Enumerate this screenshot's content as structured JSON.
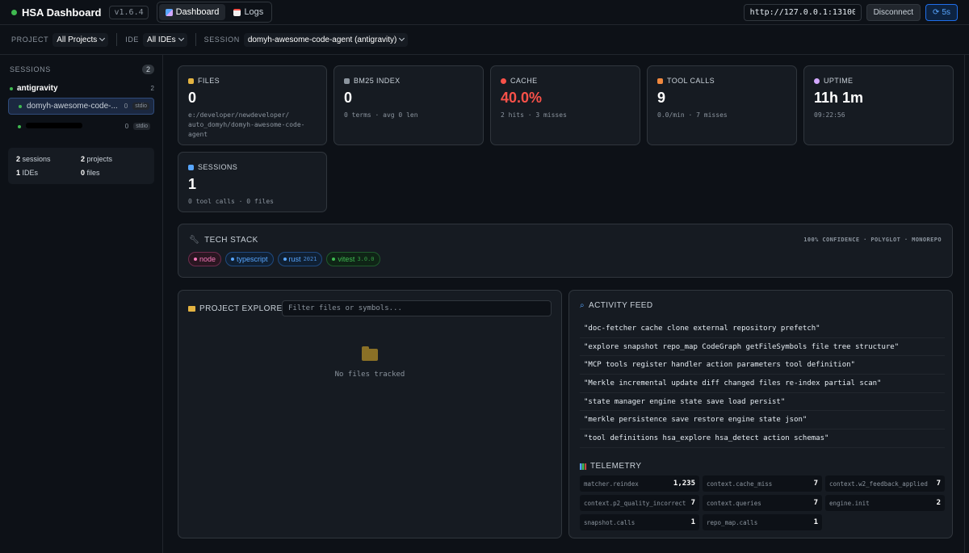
{
  "header": {
    "brand": "HSA Dashboard",
    "version": "v1.6.4",
    "tabs": [
      {
        "label": "Dashboard",
        "icon": "dashboard-icon",
        "active": true
      },
      {
        "label": "Logs",
        "icon": "logs-icon",
        "active": false
      }
    ],
    "server_url": "http://127.0.0.1:13100",
    "disconnect_label": "Disconnect",
    "refresh_label": "5s",
    "accent": "#58a6ff",
    "status_color": "#3fb950"
  },
  "filters": {
    "project_label": "PROJECT",
    "project_value": "All Projects",
    "ide_label": "IDE",
    "ide_value": "All IDEs",
    "session_label": "SESSION",
    "session_value": "domyh-awesome-code-agent (antigravity)"
  },
  "sidebar": {
    "title": "SESSIONS",
    "count": "2",
    "group": {
      "name": "antigravity",
      "count": "2"
    },
    "sessions": [
      {
        "name": "domyh-awesome-code-...",
        "calls": "0",
        "transport": "stdio"
      },
      {
        "name": "",
        "calls": "0",
        "transport": "stdio"
      }
    ],
    "stats": [
      {
        "num": "2",
        "label": "sessions"
      },
      {
        "num": "2",
        "label": "projects"
      },
      {
        "num": "1",
        "label": "IDEs"
      },
      {
        "num": "0",
        "label": "files"
      }
    ]
  },
  "metrics": [
    {
      "label": "FILES",
      "value": "0",
      "sub": "e:/developer/newdeveloper/\nauto_domyh/domyh-awesome-code-\nagent",
      "icon_color": "#e3b341"
    },
    {
      "label": "BM25 INDEX",
      "value": "0",
      "sub": "0 terms · avg 0 len",
      "icon_color": "#8b949e"
    },
    {
      "label": "CACHE",
      "value": "40.0%",
      "sub": "2 hits · 3 misses",
      "icon_color": "#f85149"
    },
    {
      "label": "TOOL CALLS",
      "value": "9",
      "sub": "0.0/min · 7 misses",
      "icon_color": "#f0883e"
    },
    {
      "label": "UPTIME",
      "value": "11h 1m",
      "sub": "09:22:56",
      "icon_color": "#d2a8ff"
    },
    {
      "label": "SESSIONS",
      "value": "1",
      "sub": "0 tool calls · 0 files",
      "icon_color": "#58a6ff"
    }
  ],
  "tech_stack": {
    "title": "TECH STACK",
    "meta": "100% CONFIDENCE · POLYGLOT · MONOREPO",
    "chips": [
      {
        "name": "node",
        "version": "",
        "color": "#f778ba"
      },
      {
        "name": "typescript",
        "version": "",
        "color": "#58a6ff"
      },
      {
        "name": "rust",
        "version": "2021",
        "color": "#58a6ff"
      },
      {
        "name": "vitest",
        "version": "3.0.0",
        "color": "#3fb950"
      }
    ]
  },
  "explorer": {
    "title": "PROJECT EXPLORER",
    "filter_placeholder": "Filter files or symbols...",
    "empty_text": "No files tracked"
  },
  "activity": {
    "title": "ACTIVITY FEED",
    "items": [
      "\"doc-fetcher cache clone external repository prefetch\"",
      "\"explore snapshot repo_map CodeGraph getFileSymbols file tree structure\"",
      "\"MCP tools register handler action parameters tool definition\"",
      "\"Merkle incremental update diff changed files re-index partial scan\"",
      "\"state manager engine state save load persist\"",
      "\"merkle persistence save restore engine state json\"",
      "\"tool definitions hsa_explore hsa_detect action schemas\""
    ]
  },
  "telemetry": {
    "title": "TELEMETRY",
    "items": [
      {
        "key": "matcher.reindex",
        "value": "1,235"
      },
      {
        "key": "context.cache_miss",
        "value": "7"
      },
      {
        "key": "context.w2_feedback_applied",
        "value": "7"
      },
      {
        "key": "context.p2_quality_incorrect",
        "value": "7"
      },
      {
        "key": "context.queries",
        "value": "7"
      },
      {
        "key": "engine.init",
        "value": "2"
      },
      {
        "key": "snapshot.calls",
        "value": "1"
      },
      {
        "key": "repo_map.calls",
        "value": "1"
      }
    ]
  }
}
